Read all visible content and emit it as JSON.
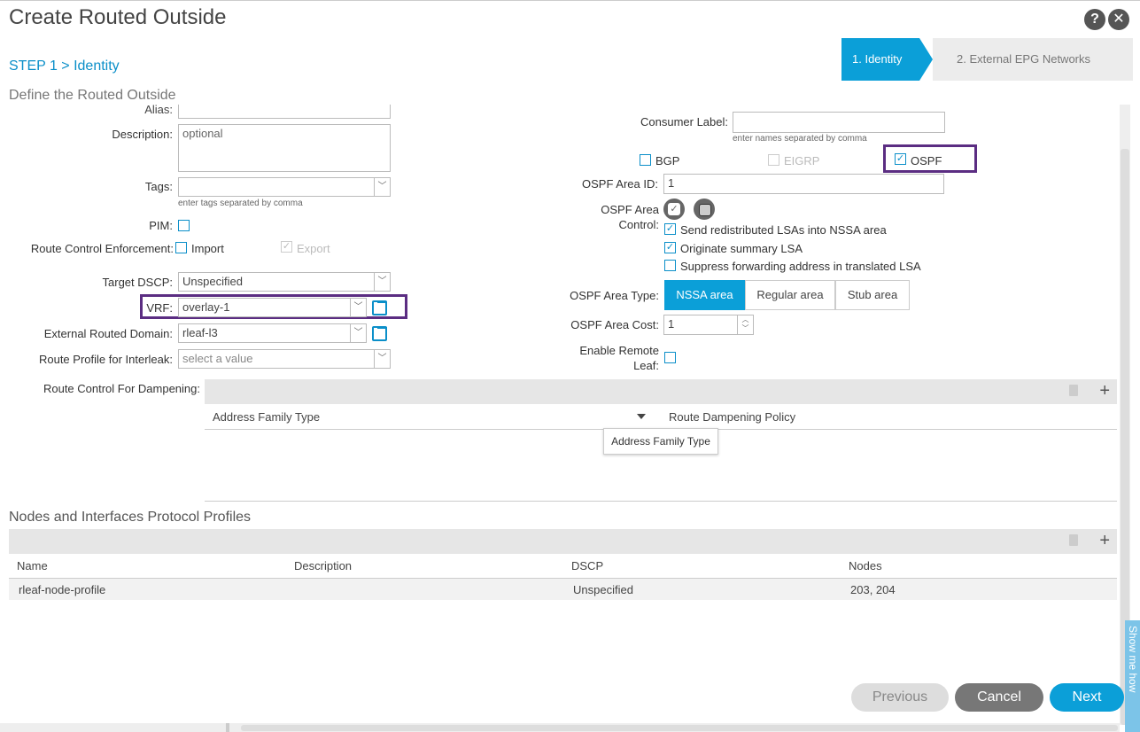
{
  "window": {
    "title": "Create Routed Outside",
    "help_glyph": "?",
    "close_glyph": "✕"
  },
  "step": {
    "label": "STEP 1 > Identity",
    "subtitle": "Define the Routed Outside"
  },
  "wizard": {
    "tabs": [
      {
        "label": "1. Identity"
      },
      {
        "label": "2. External EPG Networks"
      }
    ]
  },
  "left": {
    "alias_label": "Alias:",
    "description_label": "Description:",
    "description_placeholder": "optional",
    "tags_label": "Tags:",
    "tags_hint": "enter tags separated by comma",
    "pim_label": "PIM:",
    "rce_label": "Route Control Enforcement:",
    "rce_import": "Import",
    "rce_export": "Export",
    "dscp_label": "Target DSCP:",
    "dscp_value": "Unspecified",
    "vrf_label": "VRF:",
    "vrf_value": "overlay-1",
    "erd_label": "External Routed Domain:",
    "erd_value": "rleaf-l3",
    "rpi_label": "Route Profile for Interleak:",
    "rpi_placeholder": "select a value",
    "rcd_label": "Route Control For Dampening:"
  },
  "right": {
    "consumer_label": "Consumer Label:",
    "consumer_hint": "enter names separated by comma",
    "bgp": "BGP",
    "eigrp": "EIGRP",
    "ospf": "OSPF",
    "area_id_label": "OSPF Area ID:",
    "area_id_value": "1",
    "area_control_label": "OSPF Area",
    "area_control_label2": "Control:",
    "ctrl1": "Send redistributed LSAs into NSSA area",
    "ctrl2": "Originate summary LSA",
    "ctrl3": "Suppress forwarding address in translated LSA",
    "area_type_label": "OSPF Area Type:",
    "area_types": [
      "NSSA area",
      "Regular area",
      "Stub area"
    ],
    "area_cost_label": "OSPF Area Cost:",
    "area_cost_value": "1",
    "remote_leaf_label": "Enable Remote",
    "remote_leaf_label2": "Leaf:"
  },
  "dampening_table": {
    "col1": "Address Family Type",
    "col2": "Route Dampening Policy",
    "tooltip": "Address Family Type",
    "add_glyph": "+"
  },
  "nodes": {
    "title": "Nodes and Interfaces Protocol Profiles",
    "headers": [
      "Name",
      "Description",
      "DSCP",
      "Nodes"
    ],
    "rows": [
      {
        "name": "rleaf-node-profile",
        "description": "",
        "dscp": "Unspecified",
        "nodes": "203, 204"
      }
    ],
    "add_glyph": "+"
  },
  "footer": {
    "previous": "Previous",
    "cancel": "Cancel",
    "next": "Next"
  },
  "side_tab": "Show me how",
  "colors": {
    "accent": "#0b9fd8",
    "highlight": "#5b2d82"
  }
}
